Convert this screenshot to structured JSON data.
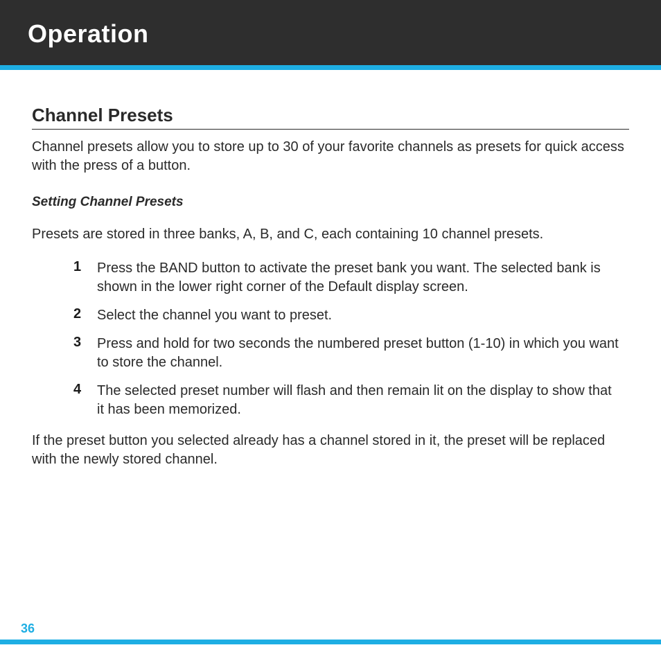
{
  "header": {
    "title": "Operation"
  },
  "section": {
    "heading": "Channel Presets",
    "intro": "Channel presets allow you to store up to 30 of your favorite channels as presets for quick access with the press of a button.",
    "subheading": "Setting Channel Presets",
    "lead": "Presets are stored in three banks, A, B, and C, each containing 10 channel presets.",
    "steps": [
      {
        "num": "1",
        "text": "Press the BAND button to activate the preset bank you want. The selected bank is shown in the lower right corner of the Default display screen."
      },
      {
        "num": "2",
        "text": "Select the channel you want to preset."
      },
      {
        "num": "3",
        "text": "Press and hold for two seconds the numbered preset button (1-10) in which you want to store the channel."
      },
      {
        "num": "4",
        "text": "The selected preset number will flash and then remain lit on the display to show that it has been memorized."
      }
    ],
    "closing": "If the preset button you selected already has a channel stored in it, the preset will be replaced with the newly stored channel."
  },
  "footer": {
    "page": "36"
  }
}
